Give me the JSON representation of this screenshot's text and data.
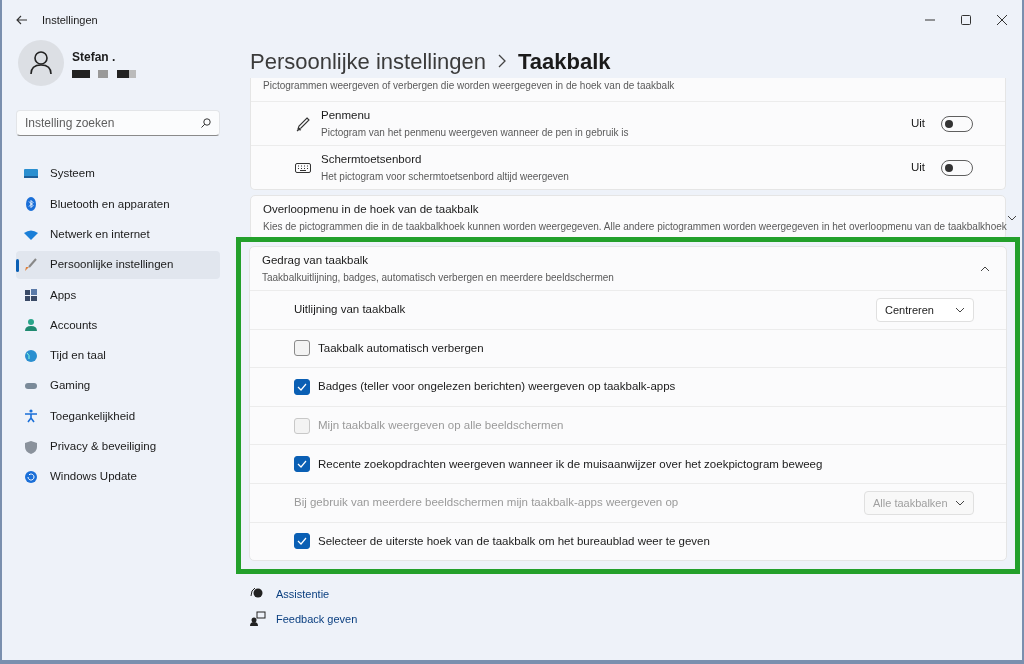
{
  "window": {
    "title": "Instellingen"
  },
  "user": {
    "name": "Stefan ."
  },
  "search": {
    "placeholder": "Instelling zoeken"
  },
  "sidebar": {
    "items": [
      {
        "label": "Systeem",
        "selected": false
      },
      {
        "label": "Bluetooth en apparaten",
        "selected": false
      },
      {
        "label": "Netwerk en internet",
        "selected": false
      },
      {
        "label": "Persoonlijke instellingen",
        "selected": true
      },
      {
        "label": "Apps",
        "selected": false
      },
      {
        "label": "Accounts",
        "selected": false
      },
      {
        "label": "Tijd en taal",
        "selected": false
      },
      {
        "label": "Gaming",
        "selected": false
      },
      {
        "label": "Toegankelijkheid",
        "selected": false
      },
      {
        "label": "Privacy & beveiliging",
        "selected": false
      },
      {
        "label": "Windows Update",
        "selected": false
      }
    ]
  },
  "breadcrumb": [
    "Persoonlijke instellingen",
    "Taakbalk"
  ],
  "sections": [
    {
      "description": "Pictogrammen weergeven of verbergen die worden weergegeven in de hoek van de taakbalk",
      "rows": [
        {
          "kind": "toggle",
          "label": "Penmenu",
          "description": "Pictogram van het penmenu weergeven wanneer de pen in gebruik is",
          "state_text": "Uit",
          "on": false
        },
        {
          "kind": "toggle",
          "label": "Schermtoetsenbord",
          "description": "Het pictogram voor schermtoetsenbord altijd weergeven",
          "state_text": "Uit",
          "on": false
        }
      ]
    },
    {
      "title": "Overloopmenu in de hoek van de taakbalk",
      "description": "Kies de pictogrammen die in de taakbalkhoek kunnen worden weergegeven. Alle andere pictogrammen worden weergegeven in het overloopmenu van de taakbalkhoek",
      "expanded": false,
      "highlighted": false
    },
    {
      "title": "Gedrag van taakbalk",
      "description": "Taakbalkuitlijning, badges, automatisch verbergen en meerdere beeldschermen",
      "expanded": true,
      "highlighted": true,
      "rows": [
        {
          "kind": "dropdown",
          "label": "Uitlijning van taakbalk",
          "value": "Centreren",
          "disabled": false
        },
        {
          "kind": "checkbox",
          "label": "Taakbalk automatisch verbergen",
          "checked": false,
          "disabled": false
        },
        {
          "kind": "checkbox",
          "label": "Badges (teller voor ongelezen berichten) weergeven op taakbalk-apps",
          "checked": true,
          "disabled": false
        },
        {
          "kind": "checkbox",
          "label": "Mijn taakbalk weergeven op alle beeldschermen",
          "checked": false,
          "disabled": true
        },
        {
          "kind": "checkbox",
          "label": "Recente zoekopdrachten weergeven wanneer ik de muisaanwijzer over het zoekpictogram beweeg",
          "checked": true,
          "disabled": false
        },
        {
          "kind": "dropdown",
          "label": "Bij gebruik van meerdere beeldschermen mijn taakbalk-apps weergeven op",
          "value": "Alle taakbalken",
          "disabled": true
        },
        {
          "kind": "checkbox",
          "label": "Selecteer de uiterste hoek van de taakbalk om het bureaublad weer te geven",
          "checked": true,
          "disabled": false
        }
      ]
    }
  ],
  "links": [
    {
      "label": "Assistentie"
    },
    {
      "label": "Feedback geven"
    }
  ]
}
